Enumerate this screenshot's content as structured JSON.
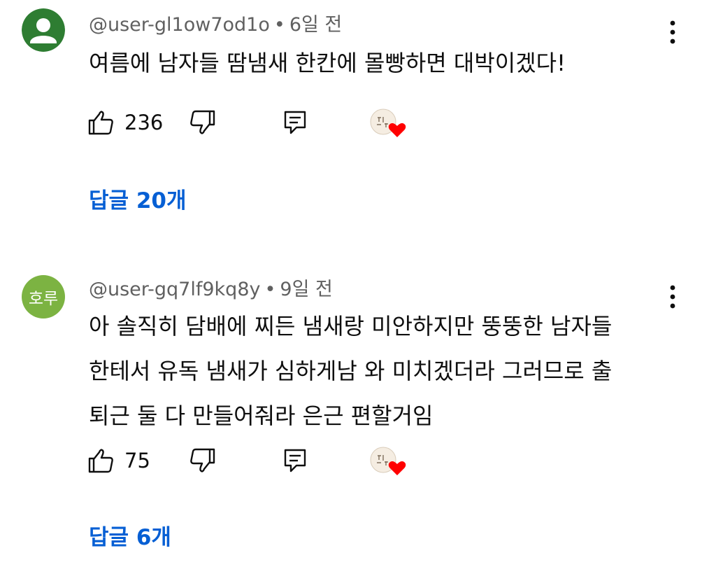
{
  "comments": [
    {
      "handle": "@user-gl1ow7od1o",
      "time": "6일 전",
      "avatar_text": "",
      "avatar_color": "#2e7d32",
      "lines": [
        "여름에 남자들 땀냄새 한칸에 몰빵하면 대박이겠다!"
      ],
      "likes": "236",
      "replies_label": "답글 20개"
    },
    {
      "handle": "@user-gq7lf9kq8y",
      "time": "9일 전",
      "avatar_text": "호루",
      "avatar_color": "#7cb342",
      "lines": [
        "아 솔직히 담배에 찌든 냄새랑 미안하지만 뚱뚱한 남자들",
        "한테서 유독 냄새가 심하게남 와 미치겠더라 그러므로 출",
        "퇴근 둘 다 만들어줘라 은근 편할거임"
      ],
      "likes": "75",
      "replies_label": "답글 6개"
    }
  ],
  "separator": "•",
  "colors": {
    "meta_text": "#606060",
    "reply_link": "#065fd4",
    "heart": "#ff0000"
  },
  "icons": {
    "like": "thumb-up-icon",
    "dislike": "thumb-down-icon",
    "reply": "reply-comment-icon",
    "menu": "more-vert-icon",
    "creator": "creator-heart-icon"
  }
}
